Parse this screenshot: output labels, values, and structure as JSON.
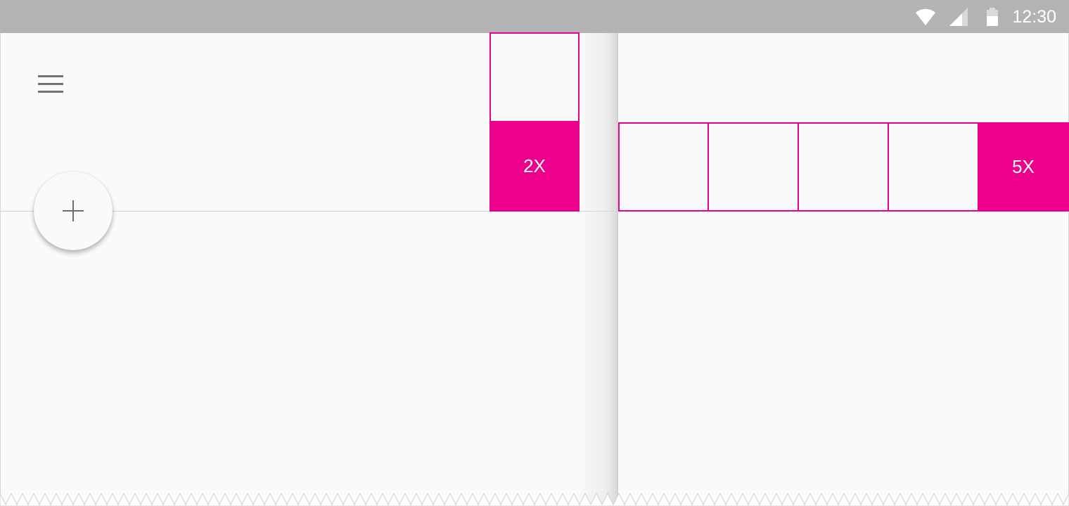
{
  "status_bar": {
    "time": "12:30",
    "icons": [
      "wifi-icon",
      "cellular-signal-icon",
      "battery-icon"
    ],
    "background_color": "#b3b3b3"
  },
  "left_screen": {
    "menu_icon": "hamburger-menu-icon",
    "fab_icon": "plus-icon",
    "keyline_label": "2X"
  },
  "right_screen": {
    "keyline_label": "5X"
  },
  "colors": {
    "accent": "#ec008c",
    "background": "#fafafa",
    "icon_gray": "#737373"
  }
}
